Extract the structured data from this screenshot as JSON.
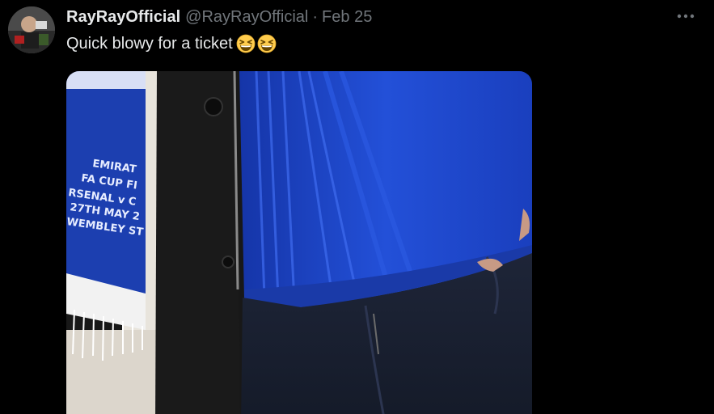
{
  "tweet": {
    "display_name": "RayRayOfficial",
    "handle": "@RayRayOfficial",
    "separator": "·",
    "date": "Feb 25",
    "text": "Quick blowy for a ticket",
    "emojis": [
      "grinning-squinting-face",
      "grinning-squinting-face"
    ]
  },
  "media": {
    "scarf_lines": [
      "EMIRAT",
      "FA CUP FI",
      "RSENAL v C",
      "27TH MAY 2",
      "WEMBLEY ST"
    ]
  },
  "colors": {
    "background": "#000000",
    "text_primary": "#e7e9ea",
    "text_secondary": "#71767b",
    "shirt_blue": "#1f46c8",
    "scarf_blue": "#1c3fb0",
    "jeans": "#1c2233"
  }
}
